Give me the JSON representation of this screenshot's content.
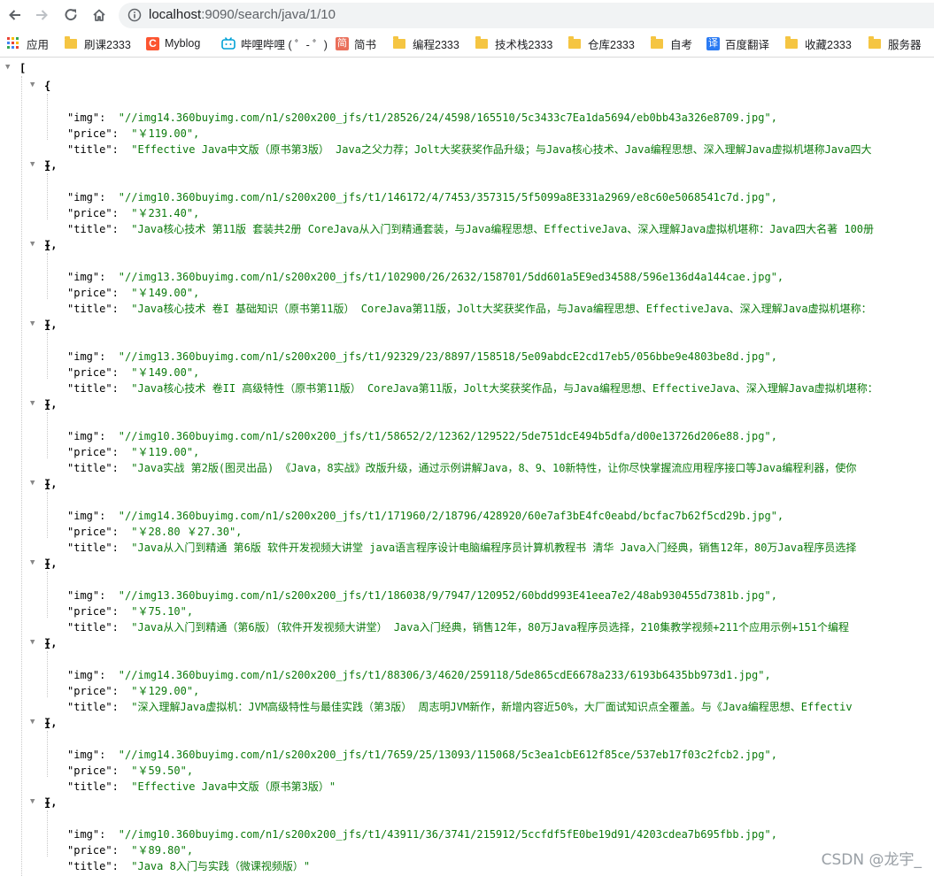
{
  "browser": {
    "url_host": "localhost",
    "url_rest": ":9090/search/java/1/10"
  },
  "bookmarks": [
    {
      "label": "应用",
      "icon": "apps-icon"
    },
    {
      "label": "刷课2333",
      "icon": "folder-icon"
    },
    {
      "label": "Myblog",
      "icon": "csdn-icon"
    },
    {
      "label": "哔哩哔哩 ( ゜- ゜)",
      "icon": "bilibili-icon"
    },
    {
      "label": "简书",
      "icon": "jianshu-icon"
    },
    {
      "label": "编程2333",
      "icon": "folder-icon"
    },
    {
      "label": "技术栈2333",
      "icon": "folder-icon"
    },
    {
      "label": "仓库2333",
      "icon": "folder-icon"
    },
    {
      "label": "自考",
      "icon": "folder-icon"
    },
    {
      "label": "百度翻译",
      "icon": "translate-icon"
    },
    {
      "label": "收藏2333",
      "icon": "folder-icon"
    },
    {
      "label": "服务器",
      "icon": "folder-icon"
    }
  ],
  "json_view": {
    "open_bracket": "[",
    "items": [
      {
        "img": "\"//img14.360buyimg.com/n1/s200x200_jfs/t1/28526/24/4598/165510/5c3433c7Ea1da5694/eb0bb43a326e8709.jpg\",",
        "price": "\"￥119.00\",",
        "title": "\"Effective Java中文版（原书第3版） Java之父力荐；Jolt大奖获奖作品升级；与Java核心技术、Java编程思想、深入理解Java虚拟机堪称Java四大"
      },
      {
        "img": "\"//img10.360buyimg.com/n1/s200x200_jfs/t1/146172/4/7453/357315/5f5099a8E331a2969/e8c60e5068541c7d.jpg\",",
        "price": "\"￥231.40\",",
        "title": "\"Java核心技术 第11版 套装共2册 CoreJava从入门到精通套装，与Java编程思想、EffectiveJava、深入理解Java虚拟机堪称：Java四大名著 100册"
      },
      {
        "img": "\"//img13.360buyimg.com/n1/s200x200_jfs/t1/102900/26/2632/158701/5dd601a5E9ed34588/596e136d4a144cae.jpg\",",
        "price": "\"￥149.00\",",
        "title": "\"Java核心技术 卷I 基础知识（原书第11版） CoreJava第11版，Jolt大奖获奖作品，与Java编程思想、EffectiveJava、深入理解Java虚拟机堪称："
      },
      {
        "img": "\"//img13.360buyimg.com/n1/s200x200_jfs/t1/92329/23/8897/158518/5e09abdcE2cd17eb5/056bbe9e4803be8d.jpg\",",
        "price": "\"￥149.00\",",
        "title": "\"Java核心技术 卷II 高级特性（原书第11版） CoreJava第11版，Jolt大奖获奖作品，与Java编程思想、EffectiveJava、深入理解Java虚拟机堪称："
      },
      {
        "img": "\"//img10.360buyimg.com/n1/s200x200_jfs/t1/58652/2/12362/129522/5de751dcE494b5dfa/d00e13726d206e88.jpg\",",
        "price": "\"￥119.00\",",
        "title": "\"Java实战 第2版(图灵出品) 《Java，8实战》改版升级，通过示例讲解Java，8、9、10新特性，让你尽快掌握流应用程序接口等Java编程利器，使你"
      },
      {
        "img": "\"//img14.360buyimg.com/n1/s200x200_jfs/t1/171960/2/18796/428920/60e7af3bE4fc0eabd/bcfac7b62f5cd29b.jpg\",",
        "price": "\"￥28.80 ￥27.30\",",
        "title": "\"Java从入门到精通 第6版 软件开发视频大讲堂 java语言程序设计电脑编程序员计算机教程书 清华 Java入门经典，销售12年，80万Java程序员选择"
      },
      {
        "img": "\"//img13.360buyimg.com/n1/s200x200_jfs/t1/186038/9/7947/120952/60bdd993E41eea7e2/48ab930455d7381b.jpg\",",
        "price": "\"￥75.10\",",
        "title": "\"Java从入门到精通（第6版）（软件开发视频大讲堂） Java入门经典，销售12年，80万Java程序员选择，210集教学视频+211个应用示例+151个编程"
      },
      {
        "img": "\"//img14.360buyimg.com/n1/s200x200_jfs/t1/88306/3/4620/259118/5de865cdE6678a233/6193b6435bb973d1.jpg\",",
        "price": "\"￥129.00\",",
        "title": "\"深入理解Java虚拟机：JVM高级特性与最佳实践（第3版） 周志明JVM新作，新增内容近50%，大厂面试知识点全覆盖。与《Java编程思想、Effectiv"
      },
      {
        "img": "\"//img14.360buyimg.com/n1/s200x200_jfs/t1/7659/25/13093/115068/5c3ea1cbE612f85ce/537eb17f03c2fcb2.jpg\",",
        "price": "\"￥59.50\",",
        "title": "\"Effective Java中文版（原书第3版）\""
      },
      {
        "img": "\"//img10.360buyimg.com/n1/s200x200_jfs/t1/43911/36/3741/215912/5ccfdf5fE0be19d91/4203cdea7b695fbb.jpg\",",
        "price": "\"￥89.80\",",
        "title": "\"Java 8入门与实践（微课视频版）\""
      }
    ]
  },
  "watermark": "CSDN @龙宇_"
}
